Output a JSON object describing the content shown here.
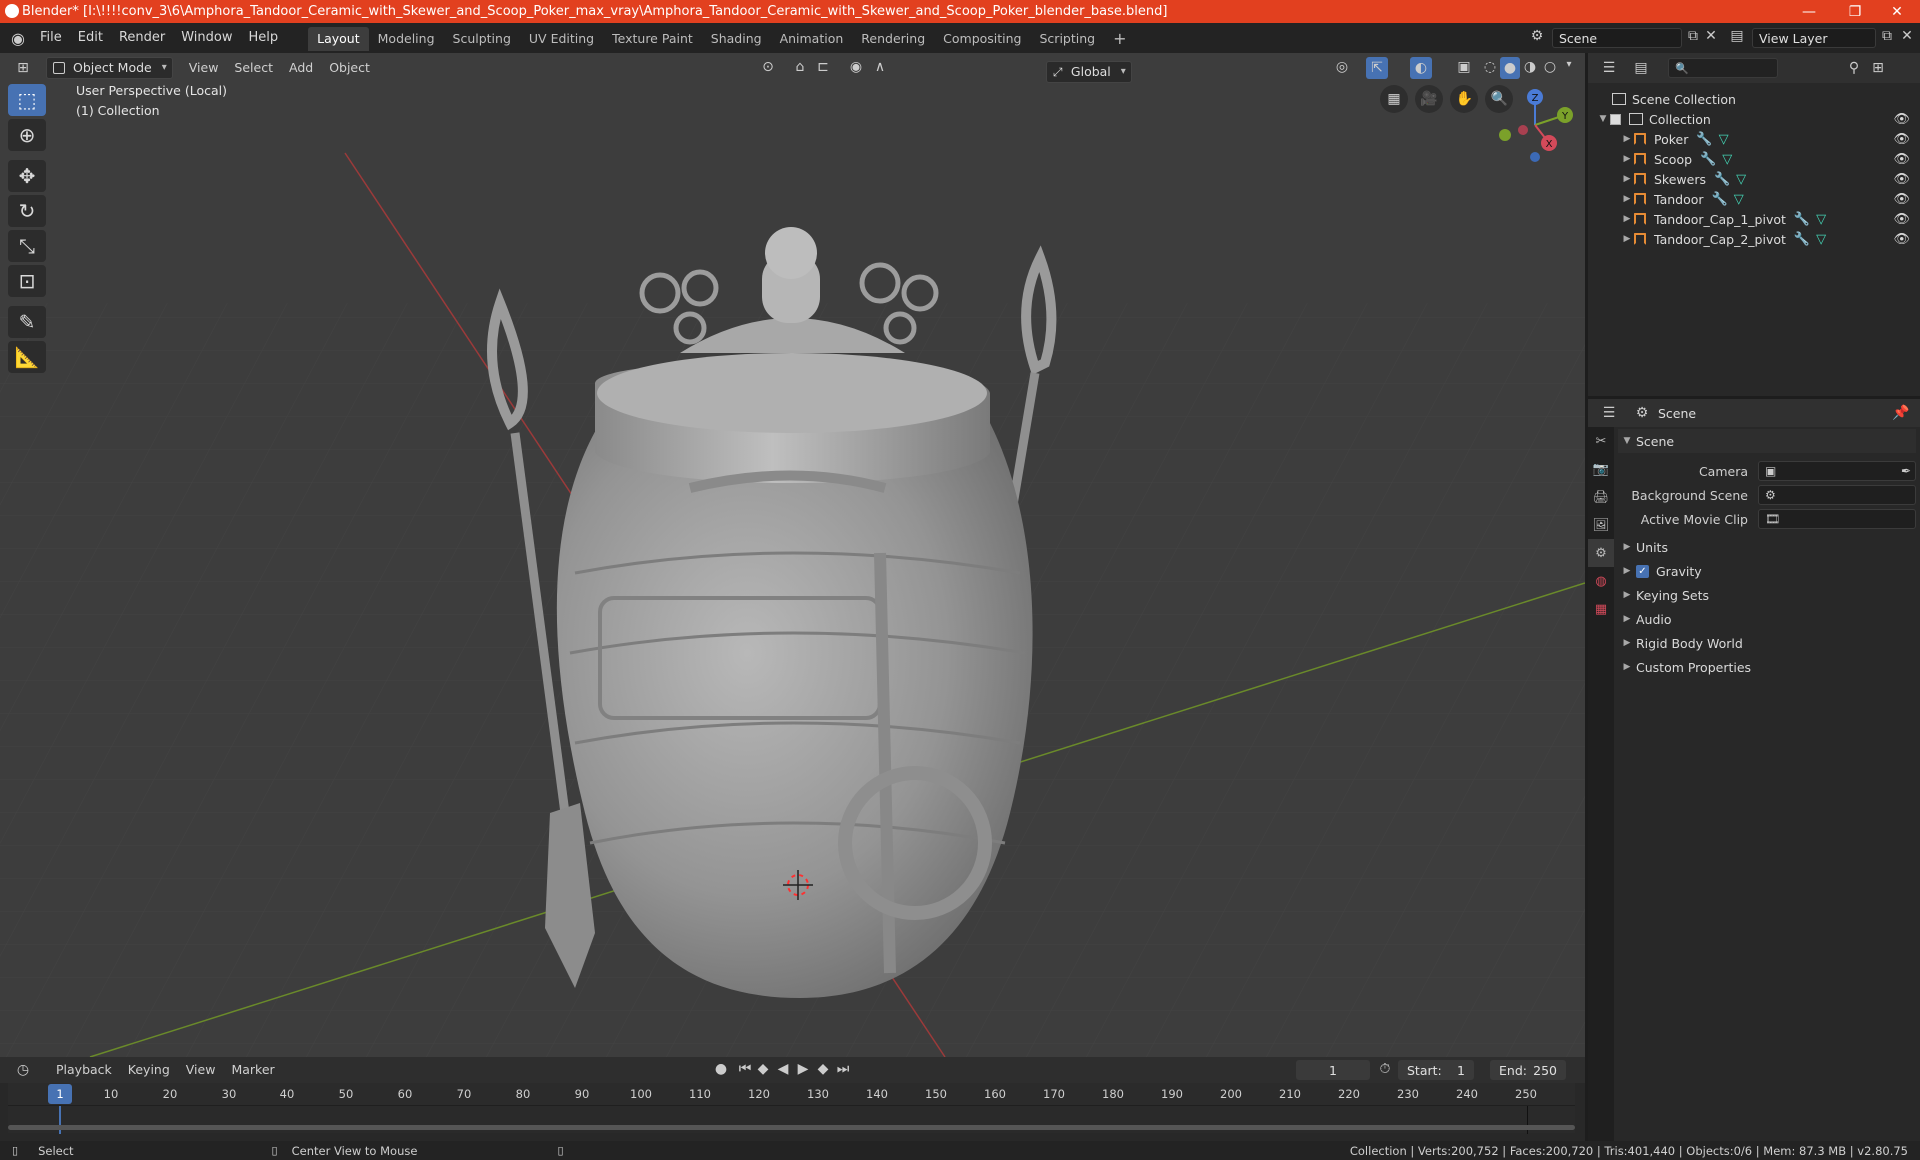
{
  "window": {
    "title": "Blender* [I:\\!!!!conv_3\\6\\Amphora_Tandoor_Ceramic_with_Skewer_and_Scoop_Poker_max_vray\\Amphora_Tandoor_Ceramic_with_Skewer_and_Scoop_Poker_blender_base.blend]",
    "minimize": "—",
    "maximize": "❐",
    "close": "✕"
  },
  "menubar": {
    "menus": [
      "File",
      "Edit",
      "Render",
      "Window",
      "Help"
    ],
    "workspaces": [
      "Layout",
      "Modeling",
      "Sculpting",
      "UV Editing",
      "Texture Paint",
      "Shading",
      "Animation",
      "Rendering",
      "Compositing",
      "Scripting"
    ],
    "active_workspace": "Layout",
    "add_workspace": "+",
    "scene_value": "Scene",
    "view_layer_value": "View Layer"
  },
  "viewport": {
    "mode": "Object Mode",
    "menus": [
      "View",
      "Select",
      "Add",
      "Object"
    ],
    "transform_orientation": "Global",
    "overlay_title": "User Perspective (Local)",
    "overlay_collection": "(1) Collection",
    "gizmo_axes": {
      "x": "X",
      "y": "Y",
      "z": "Z"
    }
  },
  "outliner": {
    "root": "Scene Collection",
    "collection": "Collection",
    "objects": [
      "Poker",
      "Scoop",
      "Skewers",
      "Tandoor",
      "Tandoor_Cap_1_pivot",
      "Tandoor_Cap_2_pivot"
    ]
  },
  "properties": {
    "breadcrumb": "Scene",
    "section_title": "Scene",
    "fields": [
      {
        "label": "Camera",
        "value": ""
      },
      {
        "label": "Background Scene",
        "value": ""
      },
      {
        "label": "Active Movie Clip",
        "value": ""
      }
    ],
    "sections": [
      "Units",
      "Gravity",
      "Keying Sets",
      "Audio",
      "Rigid Body World",
      "Custom Properties"
    ],
    "gravity_checked": true
  },
  "timeline": {
    "menus": [
      "Playback",
      "Keying",
      "View",
      "Marker"
    ],
    "current_frame": "1",
    "start_label": "Start:",
    "start": "1",
    "end_label": "End:",
    "end": "250",
    "ticks": [
      "10",
      "20",
      "30",
      "40",
      "50",
      "60",
      "70",
      "80",
      "90",
      "100",
      "110",
      "120",
      "130",
      "140",
      "150",
      "160",
      "170",
      "180",
      "190",
      "200",
      "210",
      "220",
      "230",
      "240",
      "250"
    ],
    "playhead": "1"
  },
  "statusbar": {
    "left": "Select",
    "middle": "Center View to Mouse",
    "right": "Collection | Verts:200,752 | Faces:200,720 | Tris:401,440 | Objects:0/6 | Mem: 87.3 MB | v2.80.75"
  }
}
